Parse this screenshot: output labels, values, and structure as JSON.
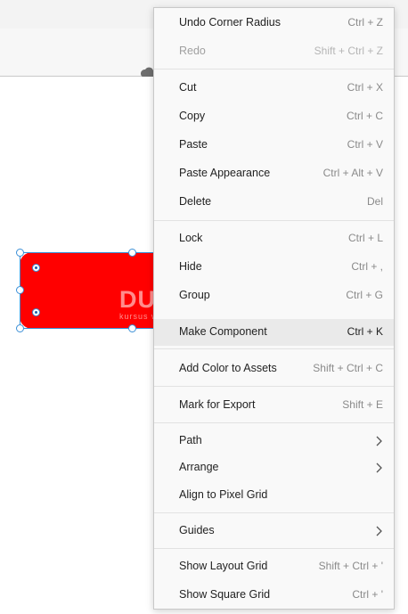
{
  "menu": {
    "undo": {
      "label": "Undo Corner Radius",
      "shortcut": "Ctrl + Z"
    },
    "redo": {
      "label": "Redo",
      "shortcut": "Shift + Ctrl + Z"
    },
    "cut": {
      "label": "Cut",
      "shortcut": "Ctrl + X"
    },
    "copy": {
      "label": "Copy",
      "shortcut": "Ctrl + C"
    },
    "paste": {
      "label": "Paste",
      "shortcut": "Ctrl + V"
    },
    "paste_appearance": {
      "label": "Paste Appearance",
      "shortcut": "Ctrl + Alt + V"
    },
    "delete": {
      "label": "Delete",
      "shortcut": "Del"
    },
    "lock": {
      "label": "Lock",
      "shortcut": "Ctrl + L"
    },
    "hide": {
      "label": "Hide",
      "shortcut": "Ctrl + ,"
    },
    "group": {
      "label": "Group",
      "shortcut": "Ctrl + G"
    },
    "make_component": {
      "label": "Make Component",
      "shortcut": "Ctrl + K"
    },
    "add_color": {
      "label": "Add Color to Assets",
      "shortcut": "Shift + Ctrl + C"
    },
    "mark_export": {
      "label": "Mark for Export",
      "shortcut": "Shift + E"
    },
    "path": {
      "label": "Path"
    },
    "arrange": {
      "label": "Arrange"
    },
    "align_pixel": {
      "label": "Align to Pixel Grid"
    },
    "guides": {
      "label": "Guides"
    },
    "layout_grid": {
      "label": "Show Layout Grid",
      "shortcut": "Shift + Ctrl + '"
    },
    "square_grid": {
      "label": "Show Square Grid",
      "shortcut": "Ctrl + '"
    }
  },
  "canvas": {
    "shape_fill": "#ff0000",
    "selection_color": "#3a8fd6"
  },
  "watermark": {
    "main": "DUMETschool",
    "sub": "kursus website dan digital marketing"
  },
  "icons": {
    "cloud": "cloud-icon",
    "submenu": "chevron-right-icon"
  }
}
